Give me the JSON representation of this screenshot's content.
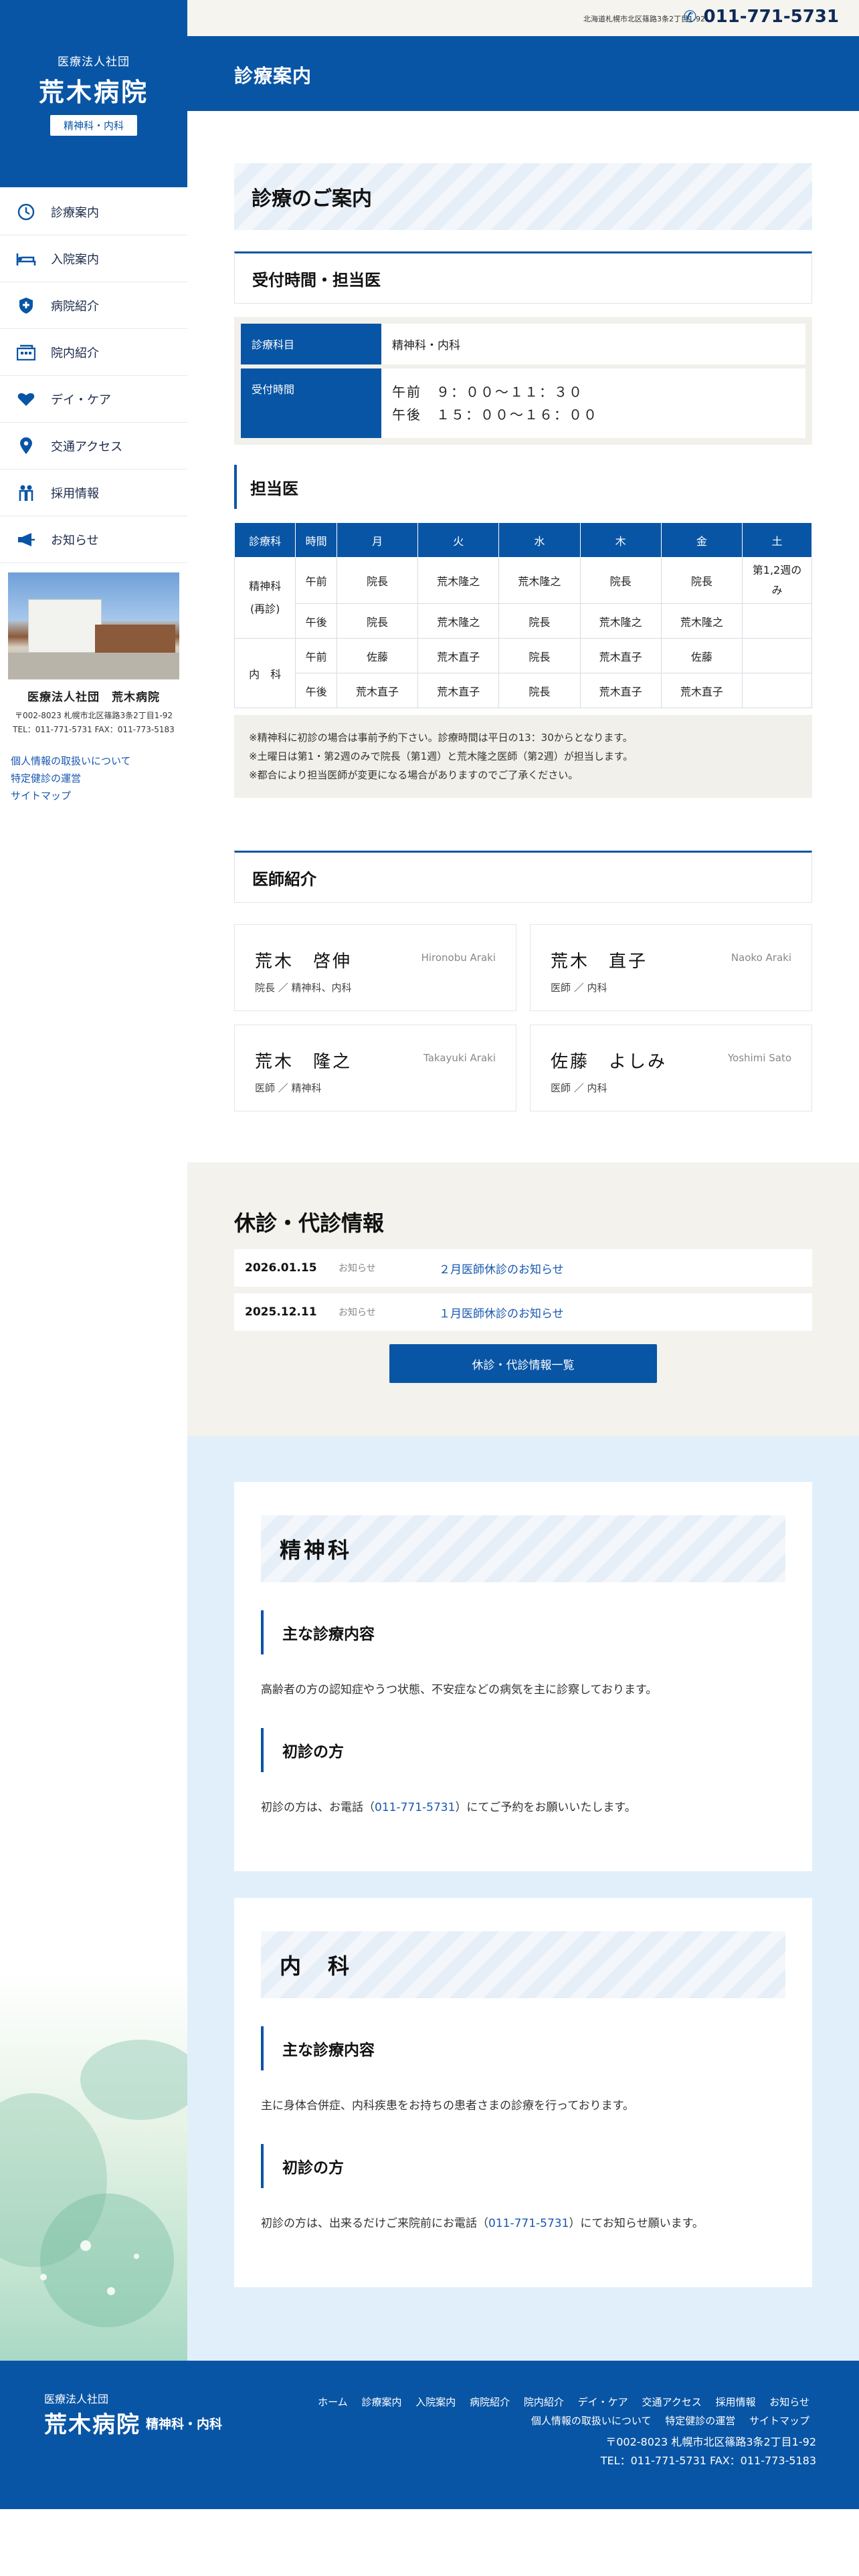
{
  "colors": {
    "brand": "#0955a5",
    "beige": "#f1f0ea",
    "light_blue": "#e1effb",
    "link": "#1757b0"
  },
  "header": {
    "address": "北海道札幌市北区篠路3条2丁目1-92",
    "phone": "011-771-5731",
    "page_title": "診療案内"
  },
  "sidebar": {
    "logo": {
      "org": "医療法人社団",
      "name": "荒木病院",
      "tag": "精神科・内科"
    },
    "nav": [
      {
        "label": "診療案内",
        "icon": "clock-icon"
      },
      {
        "label": "入院案内",
        "icon": "bed-icon"
      },
      {
        "label": "病院紹介",
        "icon": "shield-cross-icon"
      },
      {
        "label": "院内紹介",
        "icon": "building-icon"
      },
      {
        "label": "デイ・ケア",
        "icon": "heart-icon"
      },
      {
        "label": "交通アクセス",
        "icon": "map-pin-icon"
      },
      {
        "label": "採用情報",
        "icon": "people-icon"
      },
      {
        "label": "お知らせ",
        "icon": "megaphone-icon"
      }
    ],
    "info": {
      "name": "医療法人社団　荒木病院",
      "address": "〒002-8023 札幌市北区篠路3条2丁目1-92",
      "tel": "TEL：011-771-5731 FAX：011-773-5183"
    },
    "links": [
      "個人情報の取扱いについて",
      "特定健診の運営",
      "サイトマップ"
    ]
  },
  "guide": {
    "title": "診療のご案内",
    "reception_title": "受付時間・担当医",
    "rows": [
      {
        "label": "診療科目",
        "value": "精神科・内科"
      },
      {
        "label": "受付時間",
        "am": "午前　９：００〜１１：３０",
        "pm": "午後　１５：００〜１６：００"
      }
    ]
  },
  "doctors_table": {
    "title": "担当医",
    "headers": [
      "診療科",
      "時間",
      "月",
      "火",
      "水",
      "木",
      "金",
      "土"
    ],
    "psych": {
      "dept": "精神科",
      "dept2": "(再診)",
      "am": {
        "time": "午前",
        "cells": [
          "院長",
          "荒木隆之",
          "荒木隆之",
          "院長",
          "院長",
          "第1,2週のみ"
        ]
      },
      "pm": {
        "time": "午後",
        "cells": [
          "院長",
          "荒木隆之",
          "院長",
          "荒木隆之",
          "荒木隆之",
          ""
        ]
      }
    },
    "internal": {
      "dept": "内　科",
      "am": {
        "time": "午前",
        "cells": [
          "佐藤",
          "荒木直子",
          "院長",
          "荒木直子",
          "佐藤",
          ""
        ]
      },
      "pm": {
        "time": "午後",
        "cells": [
          "荒木直子",
          "荒木直子",
          "院長",
          "荒木直子",
          "荒木直子",
          ""
        ]
      }
    },
    "notes": [
      "※精神科に初診の場合は事前予約下さい。診療時間は平日の13：30からとなります。",
      "※土曜日は第1・第2週のみで院長（第1週）と荒木隆之医師（第2週）が担当します。",
      "※都合により担当医師が変更になる場合がありますのでご了承ください。"
    ]
  },
  "doctors": {
    "title": "医師紹介",
    "list": [
      {
        "name": "荒木　啓伸",
        "en": "Hironobu Araki",
        "role": "院長 ／ 精神科、内科"
      },
      {
        "name": "荒木　直子",
        "en": "Naoko Araki",
        "role": "医師 ／ 内科"
      },
      {
        "name": "荒木　隆之",
        "en": "Takayuki Araki",
        "role": "医師 ／ 精神科"
      },
      {
        "name": "佐藤　よしみ",
        "en": "Yoshimi Sato",
        "role": "医師 ／ 内科"
      }
    ]
  },
  "news": {
    "title": "休診・代診情報",
    "items": [
      {
        "date": "2026.01.15",
        "cat": "お知らせ",
        "title": "２月医師休診のお知らせ"
      },
      {
        "date": "2025.12.11",
        "cat": "お知らせ",
        "title": "１月医師休診のお知らせ"
      }
    ],
    "button": "休診・代診情報一覧"
  },
  "depts": [
    {
      "title": "精神科",
      "sub1": "主な診療内容",
      "text1": "高齢者の方の認知症やうつ状態、不安症などの病気を主に診察しております。",
      "sub2": "初診の方",
      "text2_pre": "初診の方は、お電話（",
      "text2_tel": "011-771-5731",
      "text2_post": "）にてご予約をお願いいたします。"
    },
    {
      "title": "内　科",
      "sub1": "主な診療内容",
      "text1": "主に身体合併症、内科疾患をお持ちの患者さまの診療を行っております。",
      "sub2": "初診の方",
      "text2_pre": "初診の方は、出来るだけご来院前にお電話（",
      "text2_tel": "011-771-5731",
      "text2_post": "）にてお知らせ願います。"
    }
  ],
  "footer": {
    "org": "医療法人社団",
    "name": "荒木病院",
    "tag": "精神科・内科",
    "nav1": [
      "ホーム",
      "診療案内",
      "入院案内",
      "病院紹介",
      "院内紹介",
      "デイ・ケア",
      "交通アクセス",
      "採用情報",
      "お知らせ"
    ],
    "nav2": [
      "個人情報の取扱いについて",
      "特定健診の運営",
      "サイトマップ"
    ],
    "address": "〒002-8023 札幌市北区篠路3条2丁目1-92",
    "tel": "TEL：011-771-5731 FAX：011-773-5183"
  }
}
